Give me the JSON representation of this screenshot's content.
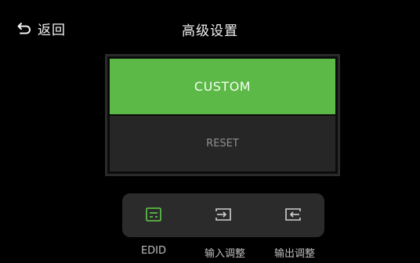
{
  "header": {
    "back_label": "返回",
    "title": "高级设置"
  },
  "options": {
    "custom_label": "CUSTOM",
    "reset_label": "RESET",
    "selected": "CUSTOM"
  },
  "tabs": [
    {
      "label": "EDID",
      "icon": "edid-icon",
      "active": true
    },
    {
      "label": "输入调整",
      "icon": "input-adjust-icon",
      "active": false
    },
    {
      "label": "输出调整",
      "icon": "output-adjust-icon",
      "active": false
    }
  ],
  "colors": {
    "accent": "#5cb847",
    "background": "#000000",
    "panel": "#262626",
    "tabbar": "#2b2b2b"
  }
}
